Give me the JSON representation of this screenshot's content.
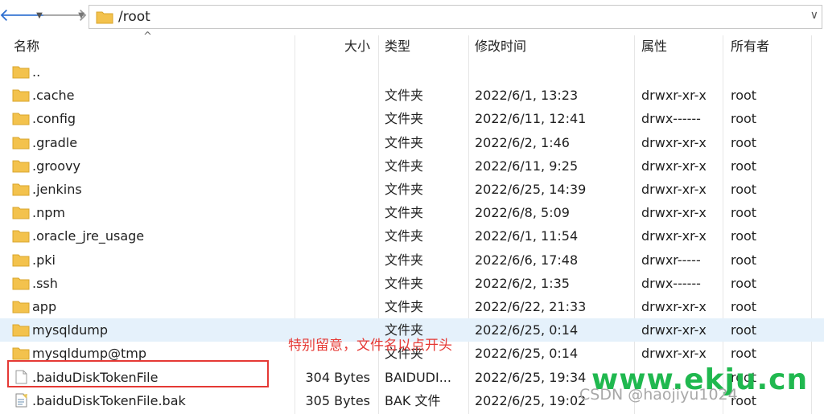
{
  "toolbar": {
    "back_icon": "arrow-left-icon",
    "forward_icon": "arrow-right-icon",
    "path": "/root"
  },
  "columns": {
    "name": "名称",
    "size": "大小",
    "type": "类型",
    "modified": "修改时间",
    "attributes": "属性",
    "owner": "所有者"
  },
  "files": [
    {
      "name": "..",
      "size": "",
      "type": "",
      "modified": "",
      "attributes": "",
      "owner": "",
      "icon": "folder-icon"
    },
    {
      "name": ".cache",
      "size": "",
      "type": "文件夹",
      "modified": "2022/6/1, 13:23",
      "attributes": "drwxr-xr-x",
      "owner": "root",
      "icon": "folder-icon"
    },
    {
      "name": ".config",
      "size": "",
      "type": "文件夹",
      "modified": "2022/6/11, 12:41",
      "attributes": "drwx------",
      "owner": "root",
      "icon": "folder-icon"
    },
    {
      "name": ".gradle",
      "size": "",
      "type": "文件夹",
      "modified": "2022/6/2, 1:46",
      "attributes": "drwxr-xr-x",
      "owner": "root",
      "icon": "folder-icon"
    },
    {
      "name": ".groovy",
      "size": "",
      "type": "文件夹",
      "modified": "2022/6/11, 9:25",
      "attributes": "drwxr-xr-x",
      "owner": "root",
      "icon": "folder-icon"
    },
    {
      "name": ".jenkins",
      "size": "",
      "type": "文件夹",
      "modified": "2022/6/25, 14:39",
      "attributes": "drwxr-xr-x",
      "owner": "root",
      "icon": "folder-icon"
    },
    {
      "name": ".npm",
      "size": "",
      "type": "文件夹",
      "modified": "2022/6/8, 5:09",
      "attributes": "drwxr-xr-x",
      "owner": "root",
      "icon": "folder-icon"
    },
    {
      "name": ".oracle_jre_usage",
      "size": "",
      "type": "文件夹",
      "modified": "2022/6/1, 11:54",
      "attributes": "drwxr-xr-x",
      "owner": "root",
      "icon": "folder-icon"
    },
    {
      "name": ".pki",
      "size": "",
      "type": "文件夹",
      "modified": "2022/6/6, 17:48",
      "attributes": "drwxr-----",
      "owner": "root",
      "icon": "folder-icon"
    },
    {
      "name": ".ssh",
      "size": "",
      "type": "文件夹",
      "modified": "2022/6/2, 1:35",
      "attributes": "drwx------",
      "owner": "root",
      "icon": "folder-icon"
    },
    {
      "name": "app",
      "size": "",
      "type": "文件夹",
      "modified": "2022/6/22, 21:33",
      "attributes": "drwxr-xr-x",
      "owner": "root",
      "icon": "folder-icon"
    },
    {
      "name": "mysqldump",
      "size": "",
      "type": "文件夹",
      "modified": "2022/6/25, 0:14",
      "attributes": "drwxr-xr-x",
      "owner": "root",
      "icon": "folder-icon",
      "selected": true
    },
    {
      "name": "mysqldump@tmp",
      "size": "",
      "type": "文件夹",
      "modified": "2022/6/25, 0:14",
      "attributes": "drwxr-xr-x",
      "owner": "root",
      "icon": "folder-icon"
    },
    {
      "name": ".baiduDiskTokenFile",
      "size": "304 Bytes",
      "type": "BAIDUDI...",
      "modified": "2022/6/25, 19:34",
      "attributes": "",
      "owner": "root",
      "icon": "file-icon"
    },
    {
      "name": ".baiduDiskTokenFile.bak",
      "size": "305 Bytes",
      "type": "BAK 文件",
      "modified": "2022/6/25, 19:02",
      "attributes": "",
      "owner": "root",
      "icon": "text-file-icon"
    }
  ],
  "annotation": "特别留意，文件名以点开头",
  "watermark": {
    "site": "www.ekju.cn",
    "csdn": "CSDN @haojiyu1024"
  },
  "colors": {
    "folder": "#f3c24d",
    "selected_row": "#e5f1fb",
    "annotation_red": "#e53935",
    "watermark_green": "#20b84f"
  }
}
